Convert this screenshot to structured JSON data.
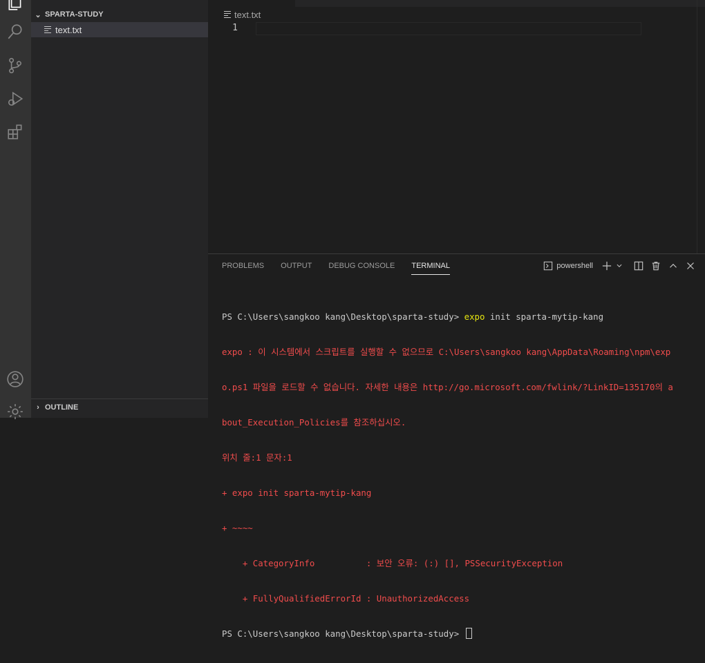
{
  "activity_bar": {
    "icons": [
      "explorer-icon",
      "search-icon",
      "source-control-icon",
      "run-debug-icon",
      "extensions-icon",
      "accounts-icon",
      "settings-gear-icon"
    ]
  },
  "sidebar": {
    "folder_name": "SPARTA-STUDY",
    "files": [
      {
        "name": "text.txt"
      }
    ],
    "outline_label": "OUTLINE"
  },
  "editor": {
    "breadcrumb_file": "text.txt",
    "line_number": "1"
  },
  "panel": {
    "tabs": [
      "PROBLEMS",
      "OUTPUT",
      "DEBUG CONSOLE",
      "TERMINAL"
    ],
    "active_tab": "TERMINAL",
    "shell_name": "powershell"
  },
  "terminal": {
    "prompt1": "PS C:\\Users\\sangkoo kang\\Desktop\\sparta-study> ",
    "cmd_name": "expo",
    "cmd_args": " init sparta-mytip-kang",
    "error_lines": [
      "expo : 이 시스템에서 스크립트를 실행할 수 없으므로 C:\\Users\\sangkoo kang\\AppData\\Roaming\\npm\\exp",
      "o.ps1 파일을 로드할 수 없습니다. 자세한 내용은 http://go.microsoft.com/fwlink/?LinkID=135170의 a",
      "bout_Execution_Policies를 참조하십시오.",
      "위치 줄:1 문자:1",
      "+ expo init sparta-mytip-kang",
      "+ ~~~~",
      "    + CategoryInfo          : 보안 오류: (:) [], PSSecurityException",
      "    + FullyQualifiedErrorId : UnauthorizedAccess"
    ],
    "prompt2": "PS C:\\Users\\sangkoo kang\\Desktop\\sparta-study> "
  },
  "colors": {
    "activity_bar_bg": "#333333",
    "sidebar_bg": "#252526",
    "editor_bg": "#1e1e1e",
    "error_red": "#f14c4c",
    "command_yellow": "#e5e510"
  }
}
